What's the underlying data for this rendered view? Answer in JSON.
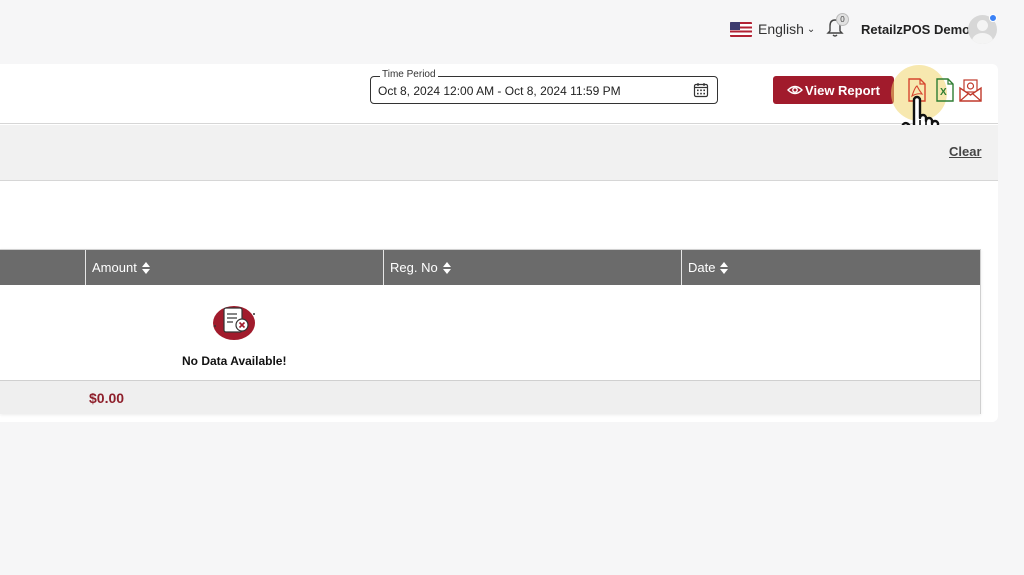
{
  "header": {
    "language": "English",
    "user_name": "RetailzPOS Demo",
    "notification_count": "0"
  },
  "report": {
    "time_period_label": "Time Period",
    "time_period_value": "Oct 8, 2024 12:00 AM - Oct 8, 2024 11:59 PM",
    "view_report_label": "View Report",
    "clear_label": "Clear"
  },
  "table": {
    "columns": [
      "",
      "Amount",
      "Reg. No",
      "Date"
    ],
    "empty_message": "No Data Available!",
    "total_amount": "$0.00"
  },
  "colors": {
    "brand": "#a11b2c",
    "header_bg": "#6b6b6b",
    "total_text": "#8e1f2b"
  }
}
